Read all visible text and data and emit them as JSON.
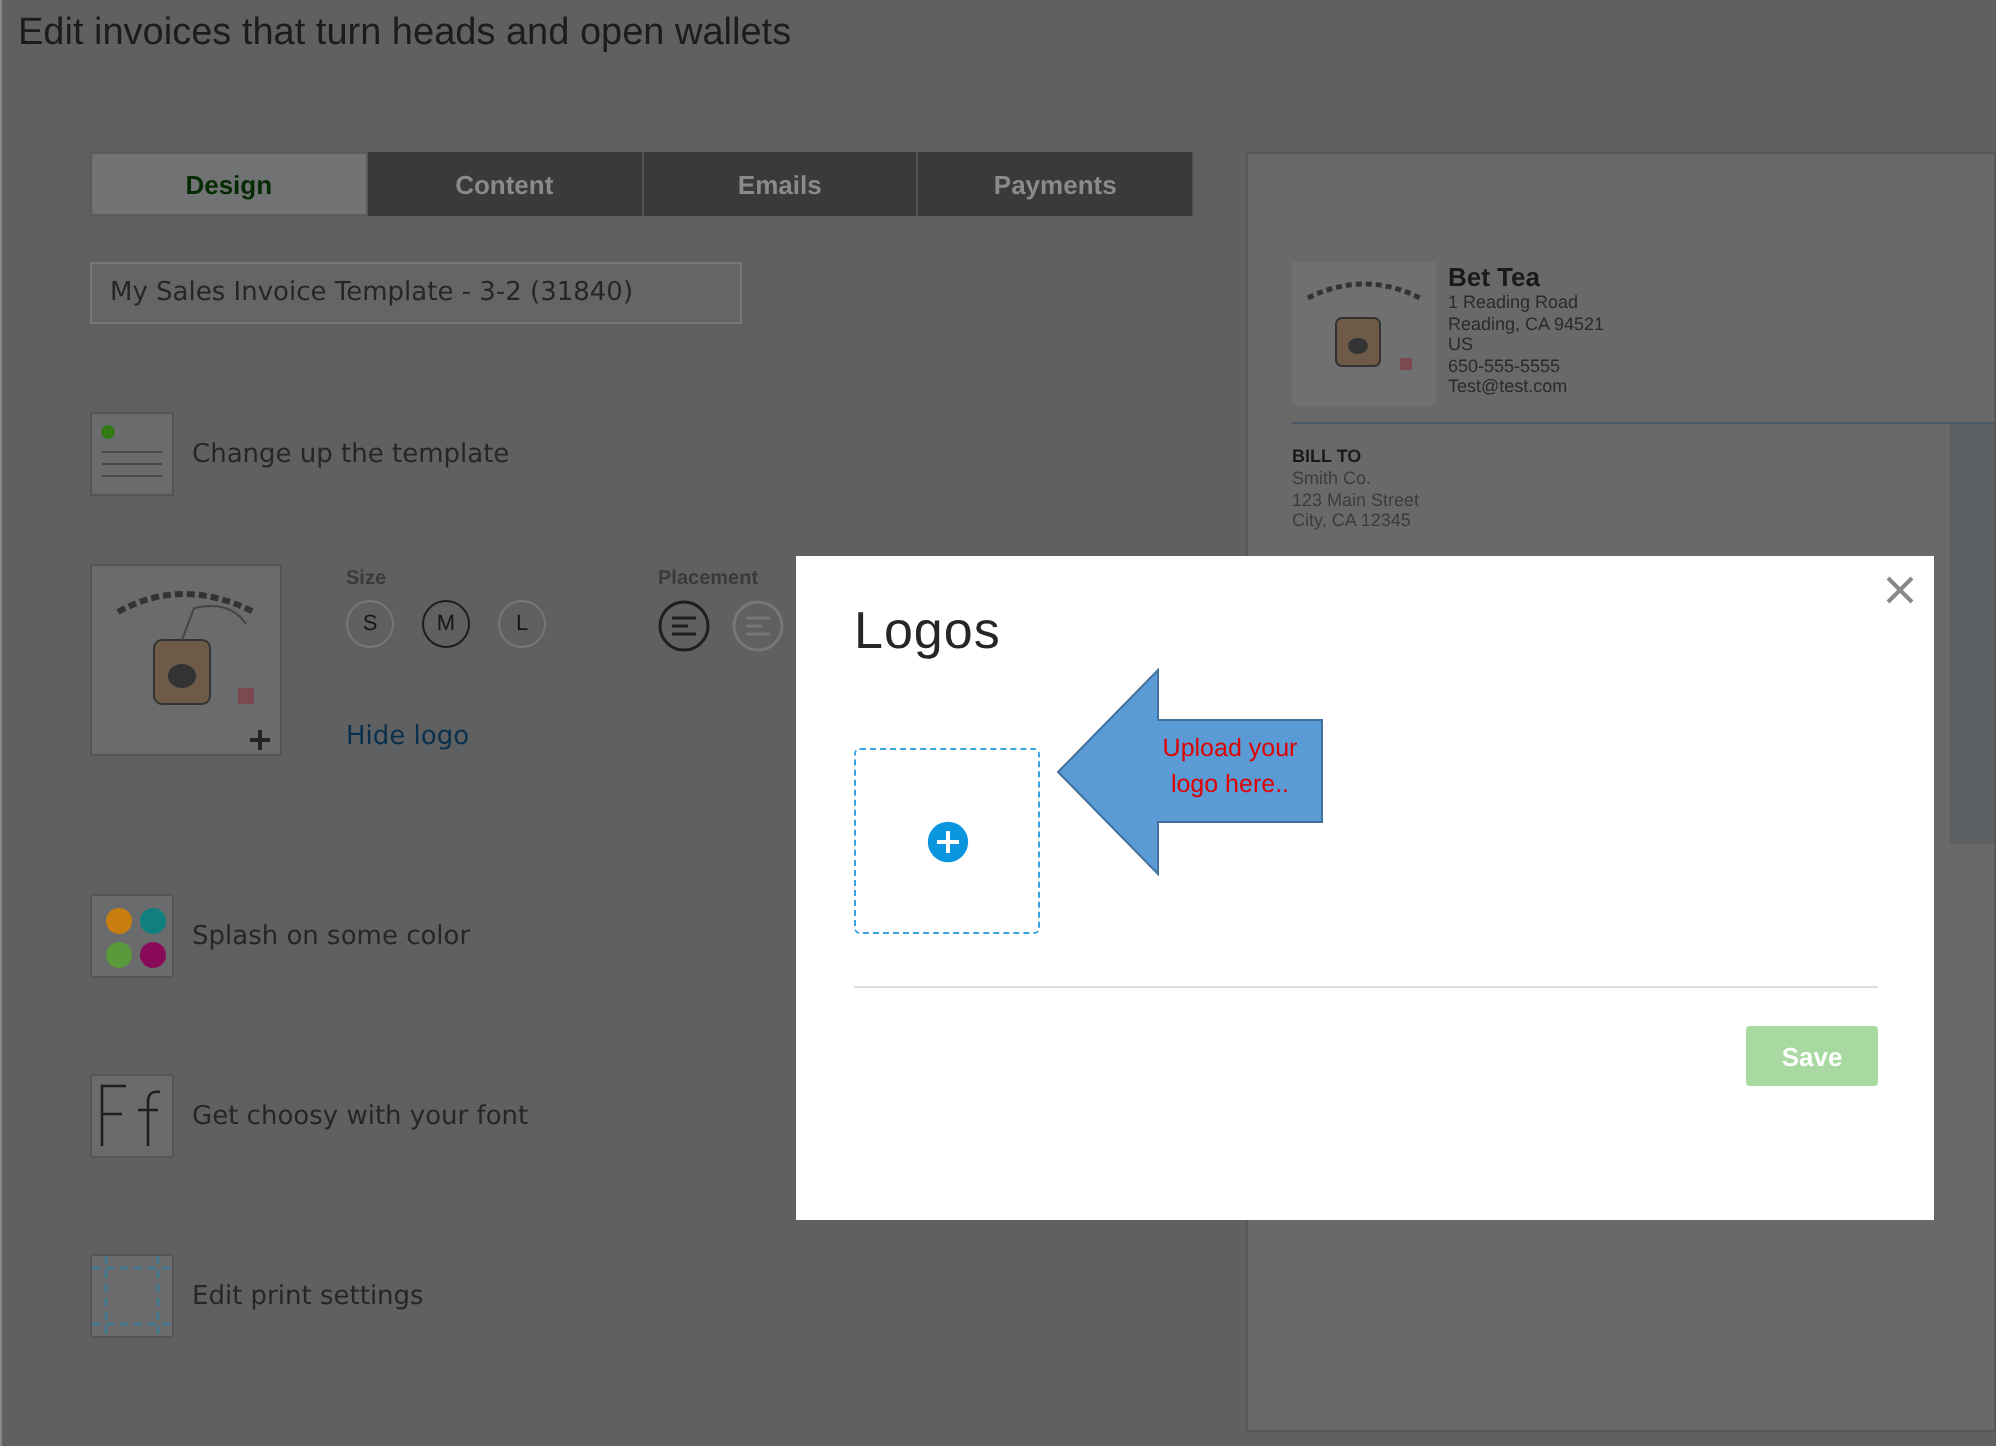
{
  "page": {
    "title": "Edit invoices that turn heads and open wallets"
  },
  "tabs": [
    {
      "label": "Design",
      "selected": true
    },
    {
      "label": "Content",
      "selected": false
    },
    {
      "label": "Emails",
      "selected": false
    },
    {
      "label": "Payments",
      "selected": false
    }
  ],
  "template_name": {
    "value": "My Sales Invoice Template - 3-2 (31840)"
  },
  "options": [
    {
      "kind": "template",
      "label": "Change up the template"
    },
    {
      "kind": "logo",
      "size_label": "Size",
      "sizes": [
        {
          "label": "S",
          "selected": false
        },
        {
          "label": "M",
          "selected": true
        },
        {
          "label": "L",
          "selected": false
        }
      ],
      "placement_label": "Placement",
      "placements": [
        {
          "selected": true
        },
        {
          "selected": false
        }
      ],
      "link": "Hide logo"
    },
    {
      "kind": "color",
      "label": "Splash on some color",
      "swatches": [
        {
          "color": "#c87f10"
        },
        {
          "color": "#0f7f80"
        },
        {
          "color": "#5a9a3c"
        },
        {
          "color": "#8a0a5a"
        }
      ]
    },
    {
      "kind": "font",
      "label": "Get choosy with your font"
    },
    {
      "kind": "print",
      "label": "Edit print settings"
    }
  ],
  "preview": {
    "company": "Bet Tea",
    "address": [
      "1 Reading Road",
      "Reading, CA 94521",
      "US",
      "650-555-5555",
      "Test@test.com"
    ],
    "bill_to_label": "BILL TO",
    "bill_to": [
      "Smith Co.",
      "123 Main Street",
      "City, CA 12345"
    ]
  },
  "dialog": {
    "title": "Logos",
    "callout": "Upload your logo here..",
    "save": {
      "label": "Save",
      "disabled": true
    }
  }
}
